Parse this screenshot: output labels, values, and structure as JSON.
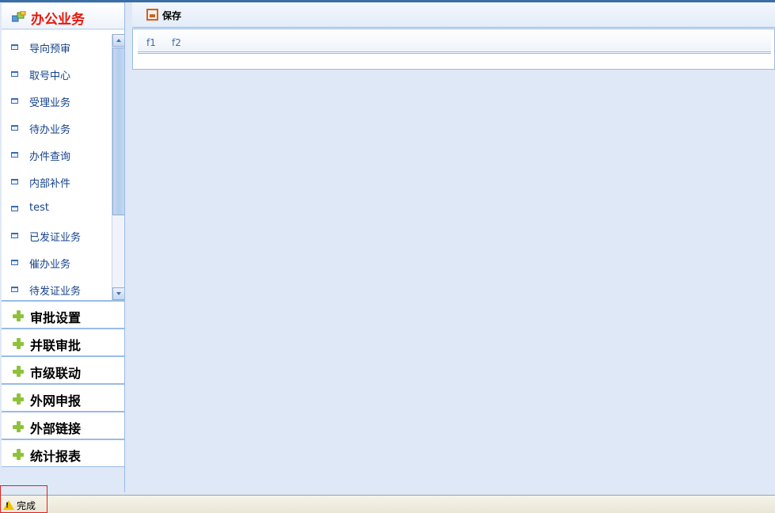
{
  "sidebar": {
    "open_section": {
      "title": "办公业务",
      "icon": "folder-group-icon"
    },
    "items": [
      {
        "label": "导向预审"
      },
      {
        "label": "取号中心"
      },
      {
        "label": "受理业务"
      },
      {
        "label": "待办业务"
      },
      {
        "label": "办件查询"
      },
      {
        "label": "内部补件"
      },
      {
        "label": "test"
      },
      {
        "label": "已发证业务"
      },
      {
        "label": "催办业务"
      },
      {
        "label": "待发证业务"
      }
    ],
    "sections": [
      {
        "title": "审批设置"
      },
      {
        "title": "并联审批"
      },
      {
        "title": "市级联动"
      },
      {
        "title": "外网申报"
      },
      {
        "title": "外部链接"
      },
      {
        "title": "统计报表"
      }
    ]
  },
  "toolbar": {
    "save_label": "保存"
  },
  "tabs": [
    {
      "label": "f1"
    },
    {
      "label": "f2"
    }
  ],
  "statusbar": {
    "text": "完成",
    "icon": "warning-icon"
  },
  "colors": {
    "active_section": "#e8180c",
    "accent": "#99bbe8",
    "background": "#dfe8f6",
    "plus": "#8fc23a"
  }
}
